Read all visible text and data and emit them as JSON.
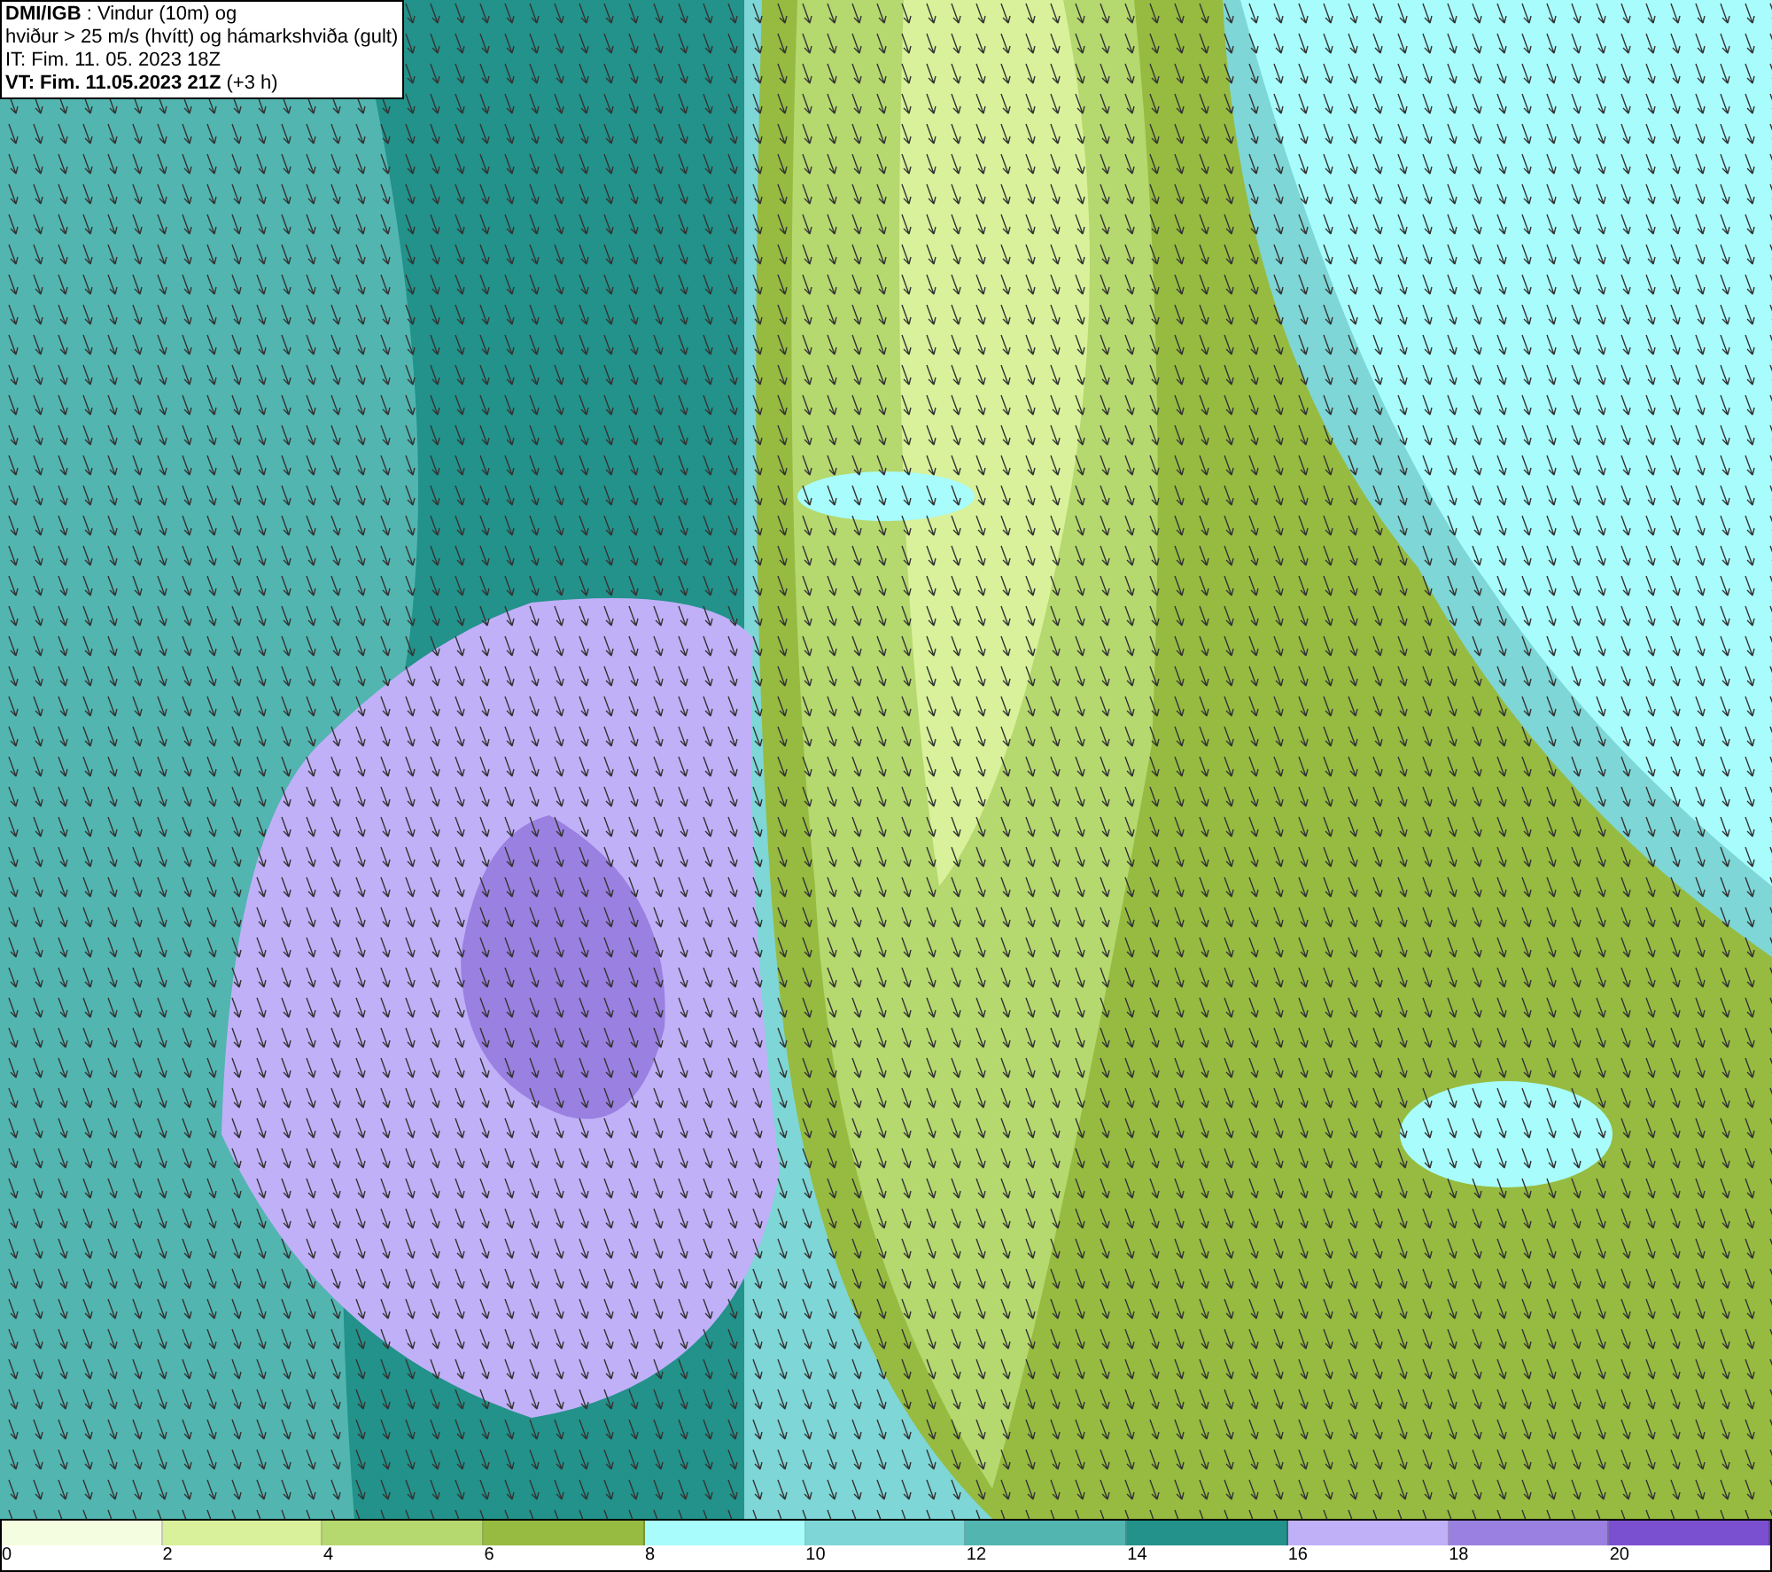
{
  "header": {
    "lines": [
      "**DMI/IGB** : Vindur (10m) og",
      "hviður > 25 m/s (hvítt) og hámarkshviða (gult)",
      "IT: Fim. 11. 05. 2023 18Z",
      "**VT: Fim. 11.05.2023 21Z** (+3 h)"
    ]
  },
  "legend": {
    "bins": [
      {
        "color": "#f5fde0",
        "label": "0"
      },
      {
        "color": "#d8f19a",
        "label": "2"
      },
      {
        "color": "#b5d86f",
        "label": "4"
      },
      {
        "color": "#96bb40",
        "label": "6"
      },
      {
        "color": "#a8fcfc",
        "label": "8"
      },
      {
        "color": "#7ed6d6",
        "label": "10"
      },
      {
        "color": "#52b5b0",
        "label": "12"
      },
      {
        "color": "#22928a",
        "label": "14"
      },
      {
        "color": "#c0b0f8",
        "label": "16"
      },
      {
        "color": "#9a80e0",
        "label": "18"
      },
      {
        "color": "#7a50d0",
        "label": "20"
      }
    ]
  }
}
